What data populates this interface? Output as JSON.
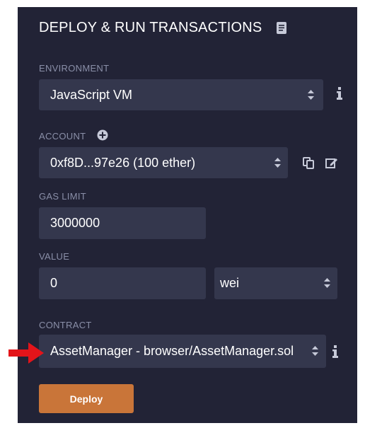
{
  "panel": {
    "title": "DEPLOY & RUN TRANSACTIONS"
  },
  "environment": {
    "label": "ENVIRONMENT",
    "value": "JavaScript VM"
  },
  "account": {
    "label": "ACCOUNT",
    "value": "0xf8D...97e26 (100 ether)"
  },
  "gas_limit": {
    "label": "GAS LIMIT",
    "value": "3000000"
  },
  "value": {
    "label": "VALUE",
    "amount": "0",
    "unit": "wei"
  },
  "contract": {
    "label": "CONTRACT",
    "value": "AssetManager - browser/AssetManager.sol"
  },
  "actions": {
    "deploy_label": "Deploy"
  },
  "colors": {
    "panel_bg": "#222336",
    "field_bg": "#34374d",
    "deploy_button": "#c97539",
    "annotation_arrow": "#e3141a"
  },
  "icons": [
    "doc-icon",
    "info-icon",
    "plus-circle-icon",
    "copy-icon",
    "edit-icon",
    "sort-icon",
    "red-arrow-icon"
  ]
}
